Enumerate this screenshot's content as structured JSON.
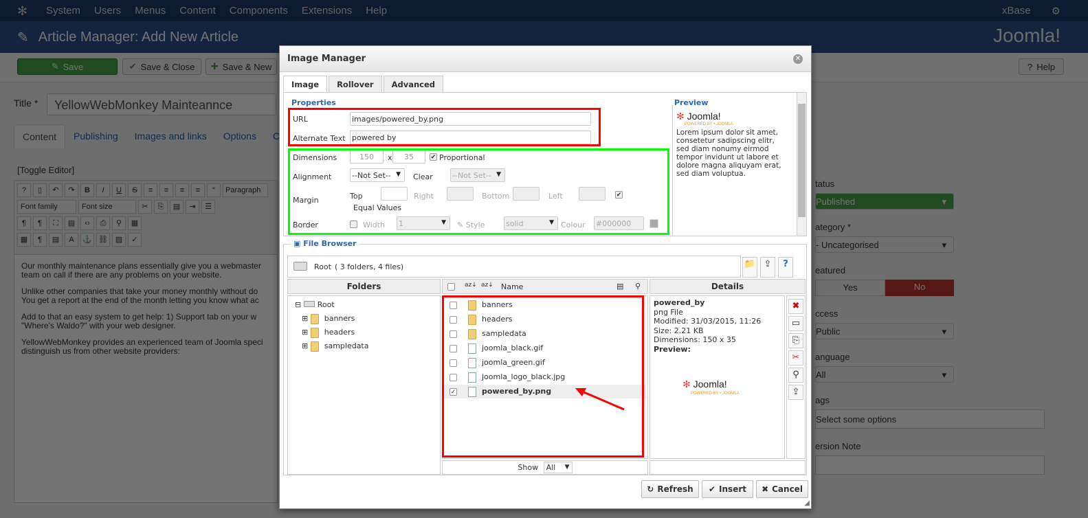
{
  "topnav": {
    "menu": [
      "System",
      "Users",
      "Menus",
      "Content",
      "Components",
      "Extensions",
      "Help"
    ],
    "site": "xBase"
  },
  "header": {
    "title": "Article Manager: Add New Article",
    "brand": "Joomla!"
  },
  "toolbar": {
    "save": "Save",
    "save_close": "Save & Close",
    "save_new": "Save & New",
    "help": "Help"
  },
  "form": {
    "title_label": "Title *",
    "title_value": "YellowWebMonkey Mainteannce",
    "tabs": [
      "Content",
      "Publishing",
      "Images and links",
      "Options",
      "Co"
    ],
    "toggle_editor": "[Toggle Editor]",
    "editor_format": "Paragraph",
    "font_family": "Font family",
    "font_size": "Font size",
    "body": [
      "Our monthly maintenance plans essentially give you a webmaster",
      "team on call if there are any problems on your website.",
      "Unlike other companies that take your money monthly without do",
      "You get a report at the end of the month letting you know what ac",
      "Add to that an easy system to get help: 1) Support tab on your w",
      "\"Where's Waldo?\" with your web designer.",
      "YellowWebMonkey provides an experienced team of Joomla speci",
      "distinguish us from other website providers:"
    ]
  },
  "sidebar": {
    "status_label": "tatus",
    "status": "Published",
    "category_label": "ategory *",
    "category": "- Uncategorised",
    "featured_label": "eatured",
    "yes": "Yes",
    "no": "No",
    "access_label": "ccess",
    "access": "Public",
    "language_label": "anguage",
    "language": "All",
    "tags_label": "ags",
    "tags_placeholder": "Select some options",
    "version_label": "ersion Note"
  },
  "dialog": {
    "title": "Image Manager",
    "tabs": [
      "Image",
      "Rollover",
      "Advanced"
    ],
    "properties": {
      "heading": "Properties",
      "url_label": "URL",
      "url": "images/powered_by.png",
      "alt_label": "Alternate Text",
      "alt": "powered by",
      "dim_label": "Dimensions",
      "width": "150",
      "x": "x",
      "height": "35",
      "proportional": "Proportional",
      "align_label": "Alignment",
      "align": "--Not Set--",
      "clear_label": "Clear",
      "clear": "--Not Set--",
      "margin_label": "Margin",
      "top": "Top",
      "right": "Right",
      "bottom": "Bottom",
      "left": "Left",
      "equal": "Equal Values",
      "border_label": "Border",
      "bwidth_label": "Width",
      "bwidth": "1",
      "style_label": "Style",
      "style": "solid",
      "colour_label": "Colour",
      "colour": "#000000"
    },
    "preview": {
      "heading": "Preview",
      "logo": "Joomla!",
      "logo_sub": "POWERED BY • JOOMLA",
      "text": "Lorem ipsum dolor sit amet, consetetur sadipscing elitr, sed diam nonumy eirmod tempor invidunt ut labore et dolore magna aliquyam erat, sed diam voluptua."
    },
    "browser": {
      "heading": "File Browser",
      "root": "Root",
      "summary": "( 3 folders, 4 files)",
      "folders_header": "Folders",
      "name_header": "Name",
      "details_header": "Details",
      "tree": [
        "Root",
        "banners",
        "headers",
        "sampledata"
      ],
      "items": [
        {
          "name": "banners",
          "type": "folder",
          "checked": false
        },
        {
          "name": "headers",
          "type": "folder",
          "checked": false
        },
        {
          "name": "sampledata",
          "type": "folder",
          "checked": false
        },
        {
          "name": "joomla_black.gif",
          "type": "file",
          "checked": false
        },
        {
          "name": "joomla_green.gif",
          "type": "file",
          "checked": false
        },
        {
          "name": "joomla_logo_black.jpg",
          "type": "file",
          "checked": false
        },
        {
          "name": "powered_by.png",
          "type": "file",
          "checked": true
        }
      ],
      "details": {
        "name": "powered_by",
        "type": "png File",
        "modified": "Modified: 31/03/2015, 11:26",
        "size": "Size: 2.21 KB",
        "dimensions": "Dimensions: 150 x 35",
        "preview": "Preview:"
      },
      "show_label": "Show",
      "show": "All"
    },
    "buttons": {
      "refresh": "Refresh",
      "insert": "Insert",
      "cancel": "Cancel"
    }
  },
  "colors": {
    "annotation_red": "#ff0000",
    "annotation_green": "#00ff00",
    "nav": "#1a3867",
    "save": "#46a546"
  }
}
